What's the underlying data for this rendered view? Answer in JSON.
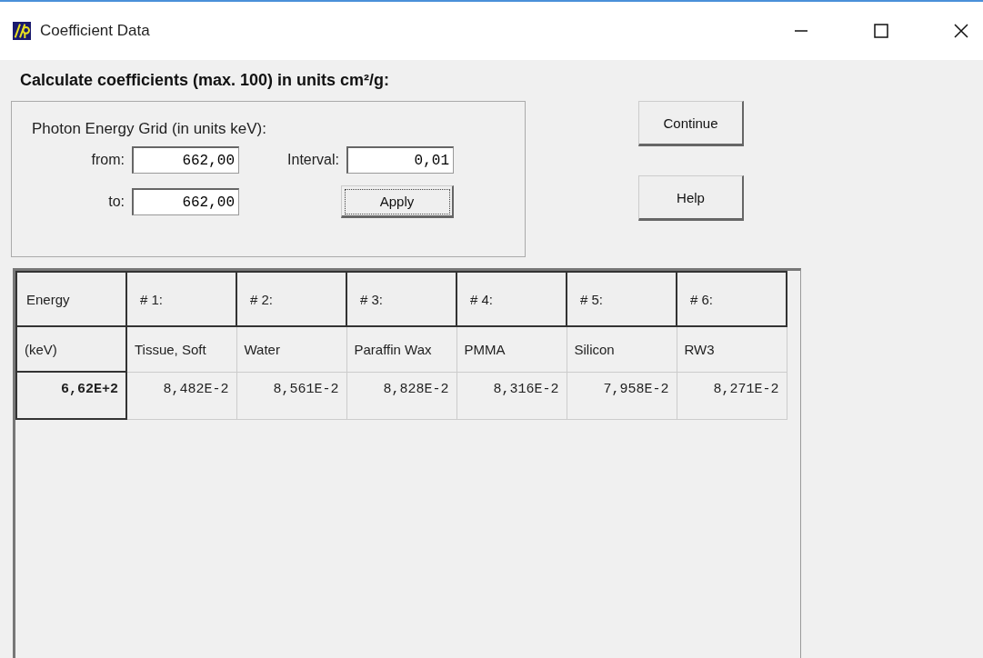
{
  "window": {
    "title": "Coefficient Data"
  },
  "heading": "Calculate coefficients (max. 100) in units cm²/g:",
  "grid": {
    "title": "Photon Energy Grid (in units keV):",
    "fields": [
      {
        "label": "from:",
        "value": "662,00"
      },
      {
        "label": "to:",
        "value": "662,00"
      }
    ],
    "interval": {
      "label": "Interval:",
      "value": "0,01"
    },
    "apply": "Apply"
  },
  "buttons": [
    "Continue",
    "Help"
  ],
  "table": {
    "columns": [
      "Energy",
      "# 1:",
      "# 2:",
      "# 3:",
      "# 4:",
      "# 5:",
      "# 6:"
    ],
    "subheaders": [
      "(keV)",
      "Tissue, Soft",
      "Water",
      "Paraffin Wax",
      "PMMA",
      "Silicon",
      "RW3"
    ],
    "rows": [
      [
        "6,62E+2",
        "8,482E-2",
        "8,561E-2",
        "8,828E-2",
        "8,316E-2",
        "7,958E-2",
        "8,271E-2"
      ]
    ]
  }
}
